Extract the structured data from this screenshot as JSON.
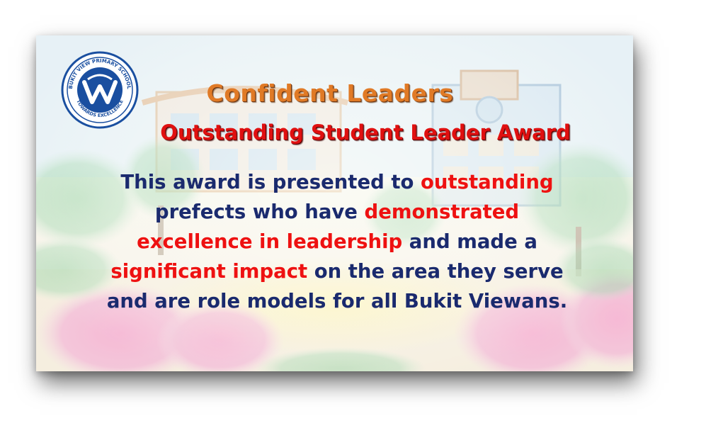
{
  "logo": {
    "ring_text_top": "BUKIT VIEW PRIMARY SCHOOL",
    "ring_text_bottom": "TOWARDS EXCELLENCE"
  },
  "heading": "Confident Leaders",
  "award_title": "Outstanding Student Leader Award",
  "description": {
    "segments": [
      {
        "text": "This award is presented to ",
        "highlight": false
      },
      {
        "text": "outstanding",
        "highlight": true
      },
      {
        "text": "prefects who have ",
        "highlight": false
      },
      {
        "text": "demonstrated",
        "highlight": true
      },
      {
        "text": "excellence in leadership",
        "highlight": true
      },
      {
        "text": " and made a",
        "highlight": false
      },
      {
        "text": "significant impact",
        "highlight": true
      },
      {
        "text": " on the area they serve",
        "highlight": false
      },
      {
        "text": "and are role models for all Bukit Viewans.",
        "highlight": false
      }
    ]
  },
  "colors": {
    "heading": "#e07a26",
    "award_title": "#e01010",
    "body_text": "#1a2a6e",
    "highlight_text": "#ee1111",
    "logo_blue": "#1a4fa0"
  }
}
